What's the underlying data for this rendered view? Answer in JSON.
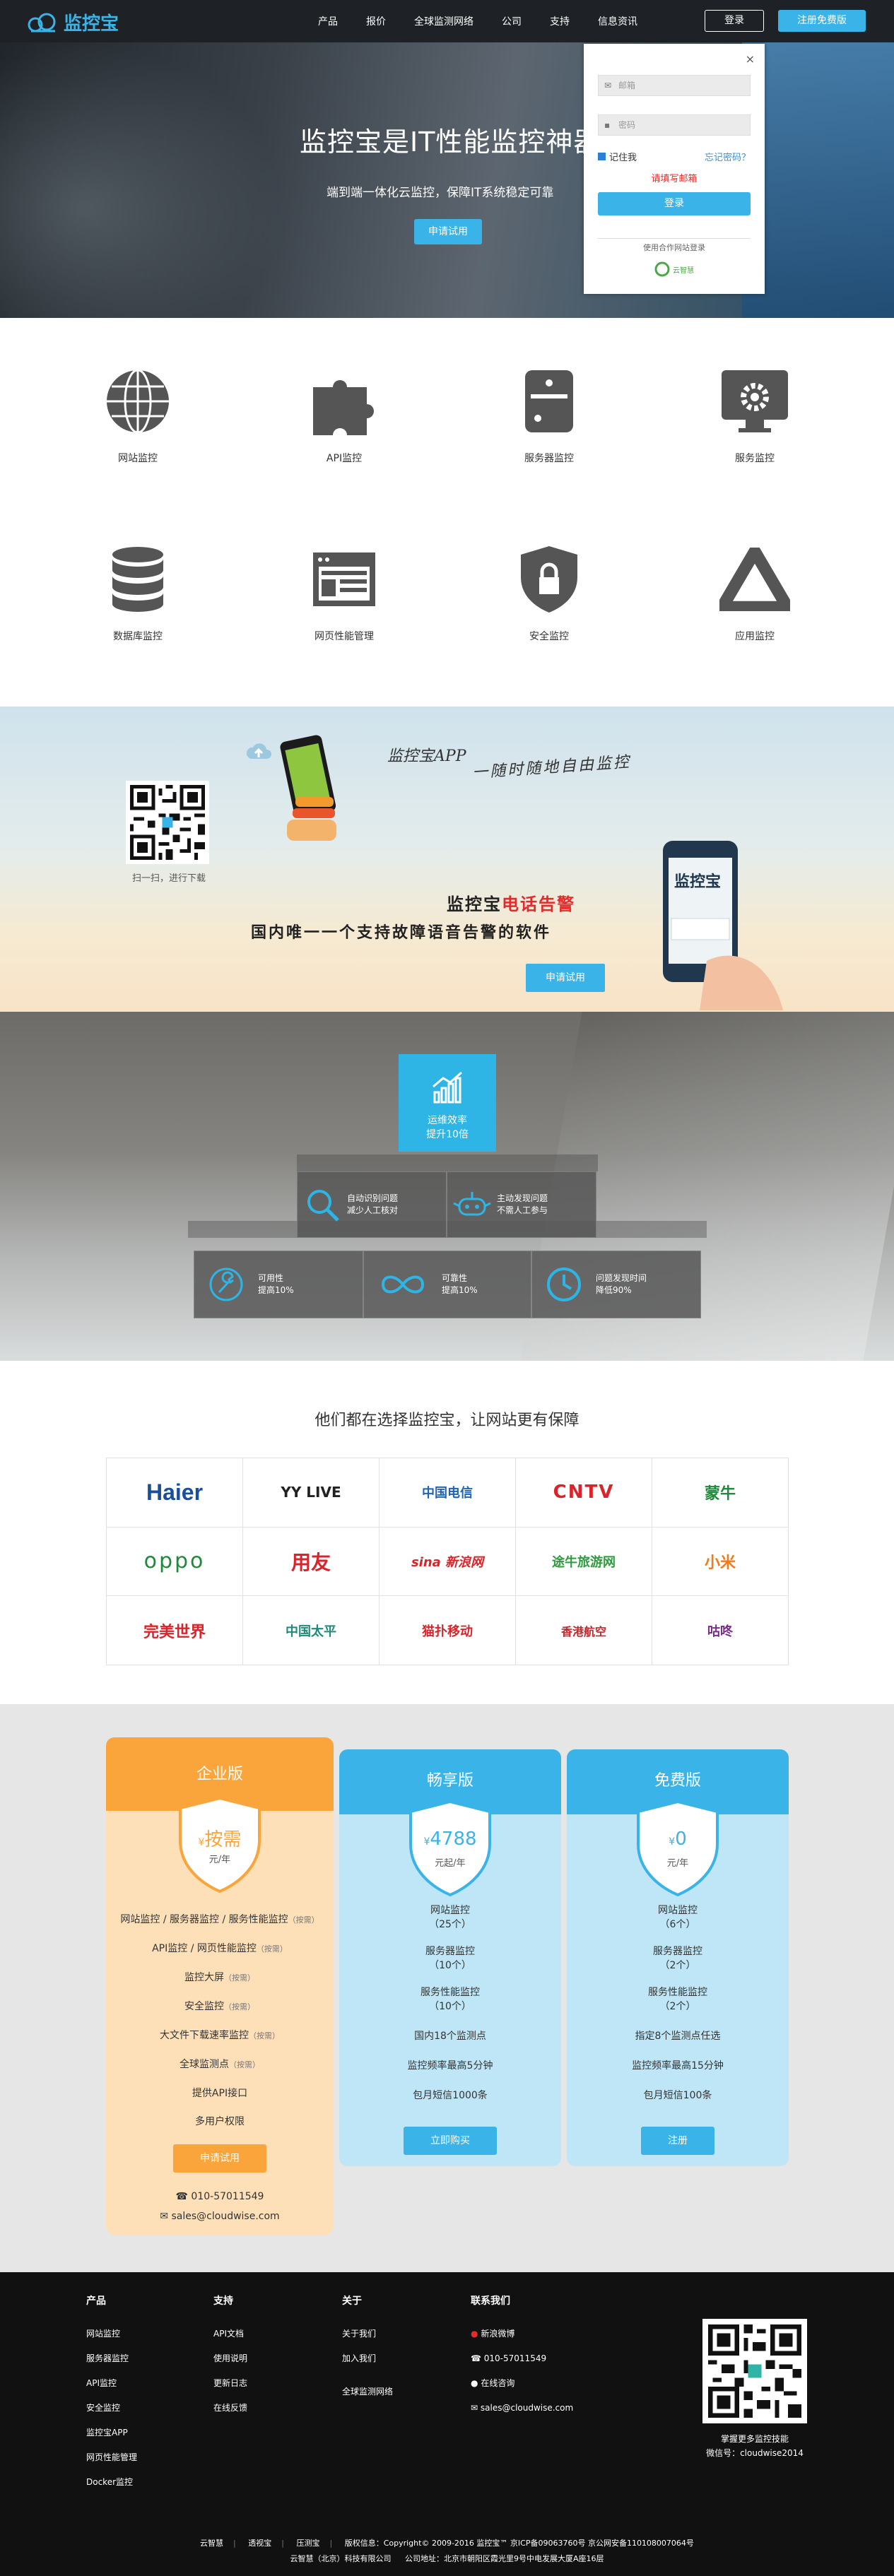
{
  "nav": {
    "logo_text": "监控宝",
    "links": [
      "产品",
      "报价",
      "全球监测网络",
      "公司",
      "支持",
      "信息资讯"
    ],
    "login": "登录",
    "register": "注册免费版"
  },
  "hero": {
    "title": "监控宝是IT性能监控神器",
    "subtitle": "端到端一体化云监控，保障IT系统稳定可靠",
    "apply": "申请试用"
  },
  "login_panel": {
    "close": "×",
    "email_placeholder": "邮箱",
    "password_placeholder": "密码",
    "remember": "记住我",
    "forgot": "忘记密码？",
    "error": "请填写邮箱",
    "submit": "登录",
    "partner_caption": "使用合作网站登录",
    "partner_name": "云智慧"
  },
  "features": [
    {
      "icon": "globe-icon",
      "label": "网站监控"
    },
    {
      "icon": "puzzle-icon",
      "label": "API监控"
    },
    {
      "icon": "server-icon",
      "label": "服务器监控"
    },
    {
      "icon": "monitor-gear-icon",
      "label": "服务监控"
    },
    {
      "icon": "database-icon",
      "label": "数据库监控"
    },
    {
      "icon": "webpage-icon",
      "label": "网页性能管理"
    },
    {
      "icon": "shield-lock-icon",
      "label": "安全监控"
    },
    {
      "icon": "triangle-icon",
      "label": "应用监控"
    }
  ],
  "app_banner": {
    "title": "监控宝APP",
    "tagline": "一随时随地自由监控",
    "qr_caption": "扫一扫，进行下载",
    "alarm_prefix": "监控宝",
    "alarm_highlight": "电话告警",
    "alarm_desc": "国内唯一一个支持故障语音告警的软件",
    "apply": "申请试用",
    "phone_text": "监控宝"
  },
  "pyramid": {
    "top": [
      "运维效率",
      "提升10倍"
    ],
    "mid": [
      {
        "icon": "magnifier-icon",
        "text": [
          "自动识别问题",
          "减少人工核对"
        ]
      },
      {
        "icon": "robot-icon",
        "text": [
          "主动发现问题",
          "不需人工参与"
        ]
      }
    ],
    "bottom": [
      {
        "icon": "wrench-icon",
        "text": [
          "可用性",
          "提高10%"
        ]
      },
      {
        "icon": "infinity-icon",
        "text": [
          "可靠性",
          "提高10%"
        ]
      },
      {
        "icon": "clock-icon",
        "text": [
          "问题发现时间",
          "降低90%"
        ]
      }
    ]
  },
  "clients": {
    "title": "他们都在选择监控宝，让网站更有保障",
    "logos": [
      {
        "name": "Haier",
        "color": "#1b4e9b"
      },
      {
        "name": "YY LIVE",
        "color": "#222222"
      },
      {
        "name": "中国电信",
        "color": "#1e63b5"
      },
      {
        "name": "CNTV",
        "color": "#d8242a"
      },
      {
        "name": "蒙牛",
        "color": "#1e8a3a"
      },
      {
        "name": "oppo",
        "color": "#1e8a3a"
      },
      {
        "name": "用友",
        "color": "#d8242a"
      },
      {
        "name": "sina 新浪网",
        "color": "#d8242a"
      },
      {
        "name": "途牛旅游网",
        "color": "#2e9b3e"
      },
      {
        "name": "小米",
        "color": "#f07a1c"
      },
      {
        "name": "完美世界",
        "color": "#d8242a"
      },
      {
        "name": "中国太平",
        "color": "#1e8a7a"
      },
      {
        "name": "猫扑移动",
        "color": "#d8242a"
      },
      {
        "name": "香港航空",
        "color": "#c0282d"
      },
      {
        "name": "咕咚",
        "color": "#7a2b8c"
      }
    ]
  },
  "pricing": {
    "plans": [
      {
        "name": "企业版",
        "price_prefix": "¥",
        "price": "按需",
        "unit": "元/年",
        "items": [
          [
            "网站监控 / 服务器监控 / 服务性能监控",
            "（按需）"
          ],
          [
            "API监控 / 网页性能监控",
            "（按需）"
          ],
          [
            "监控大屏",
            "（按需）"
          ],
          [
            "安全监控",
            "（按需）"
          ],
          [
            "大文件下载速率监控",
            "（按需）"
          ],
          [
            "全球监测点",
            "（按需）"
          ],
          [
            "提供API接口",
            ""
          ],
          [
            "多用户权限",
            ""
          ]
        ],
        "cta": "申请试用",
        "phone": "010-57011549",
        "email": "sales@cloudwise.com",
        "color": "#f9a53c"
      },
      {
        "name": "畅享版",
        "price_prefix": "¥",
        "price": "4788",
        "unit": "元起/年",
        "items": [
          [
            "网站监控",
            "（25个）"
          ],
          [
            "服务器监控",
            "（10个）"
          ],
          [
            "服务性能监控",
            "（10个）"
          ],
          [
            "国内18个监测点",
            ""
          ],
          [
            "监控频率最高5分钟",
            ""
          ],
          [
            "包月短信1000条",
            ""
          ]
        ],
        "cta": "立即购买",
        "color": "#3ab4e8"
      },
      {
        "name": "免费版",
        "price_prefix": "¥",
        "price": "0",
        "unit": "元/年",
        "items": [
          [
            "网站监控",
            "（6个）"
          ],
          [
            "服务器监控",
            "（2个）"
          ],
          [
            "服务性能监控",
            "（2个）"
          ],
          [
            "指定8个监测点任选",
            ""
          ],
          [
            "监控频率最高15分钟",
            ""
          ],
          [
            "包月短信100条",
            ""
          ]
        ],
        "cta": "注册",
        "color": "#3ab4e8"
      }
    ]
  },
  "footer": {
    "cols": [
      {
        "title": "产品",
        "items": [
          "网站监控",
          "服务器监控",
          "API监控",
          "安全监控",
          "监控宝APP",
          "网页性能管理",
          "Docker监控"
        ]
      },
      {
        "title": "支持",
        "items": [
          "API文档",
          "使用说明",
          "更新日志",
          "在线反馈"
        ]
      },
      {
        "title": "关于",
        "items": [
          "关于我们",
          "加入我们",
          "",
          "全球监测网络"
        ]
      },
      {
        "title": "联系我们",
        "items": [
          "新浪微博",
          "010-57011549",
          "在线咨询",
          "sales@cloudwise.com"
        ]
      }
    ],
    "qr_caption": [
      "掌握更多监控技能",
      "微信号：cloudwise2014"
    ],
    "bottom_links": [
      "云智慧",
      "透视宝",
      "压测宝"
    ],
    "copyright": "版权信息：Copyright© 2009-2016 监控宝™ 京ICP备09063760号 京公网安备110108007064号",
    "company": "云智慧（北京）科技有限公司",
    "address": "公司地址：北京市朝阳区霞光里9号中电发展大厦A座16层"
  }
}
